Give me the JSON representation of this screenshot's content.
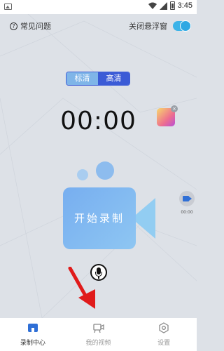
{
  "status_bar": {
    "time": "3:45",
    "icons": [
      "image-notification-icon",
      "wifi-icon",
      "signal-icon",
      "battery-icon"
    ]
  },
  "top_bar": {
    "faq_label": "常见问题",
    "float_window_label": "关闭悬浮窗",
    "float_window_toggle_on": true
  },
  "quality": {
    "options": [
      "标清",
      "高清"
    ],
    "selected": "高清"
  },
  "timer": "00:00",
  "record_button_label": "开始录制",
  "side_float": {
    "time": "00:00"
  },
  "tabs": [
    {
      "label": "录制中心",
      "icon": "home-icon",
      "active": true
    },
    {
      "label": "我的视频",
      "icon": "video-icon",
      "active": false
    },
    {
      "label": "设置",
      "icon": "settings-icon",
      "active": false
    }
  ],
  "colors": {
    "accent_blue": "#3b5bd6",
    "toggle_blue": "#3cb3e8",
    "tab_active": "#2f6fd6",
    "arrow_red": "#e01b1b"
  }
}
